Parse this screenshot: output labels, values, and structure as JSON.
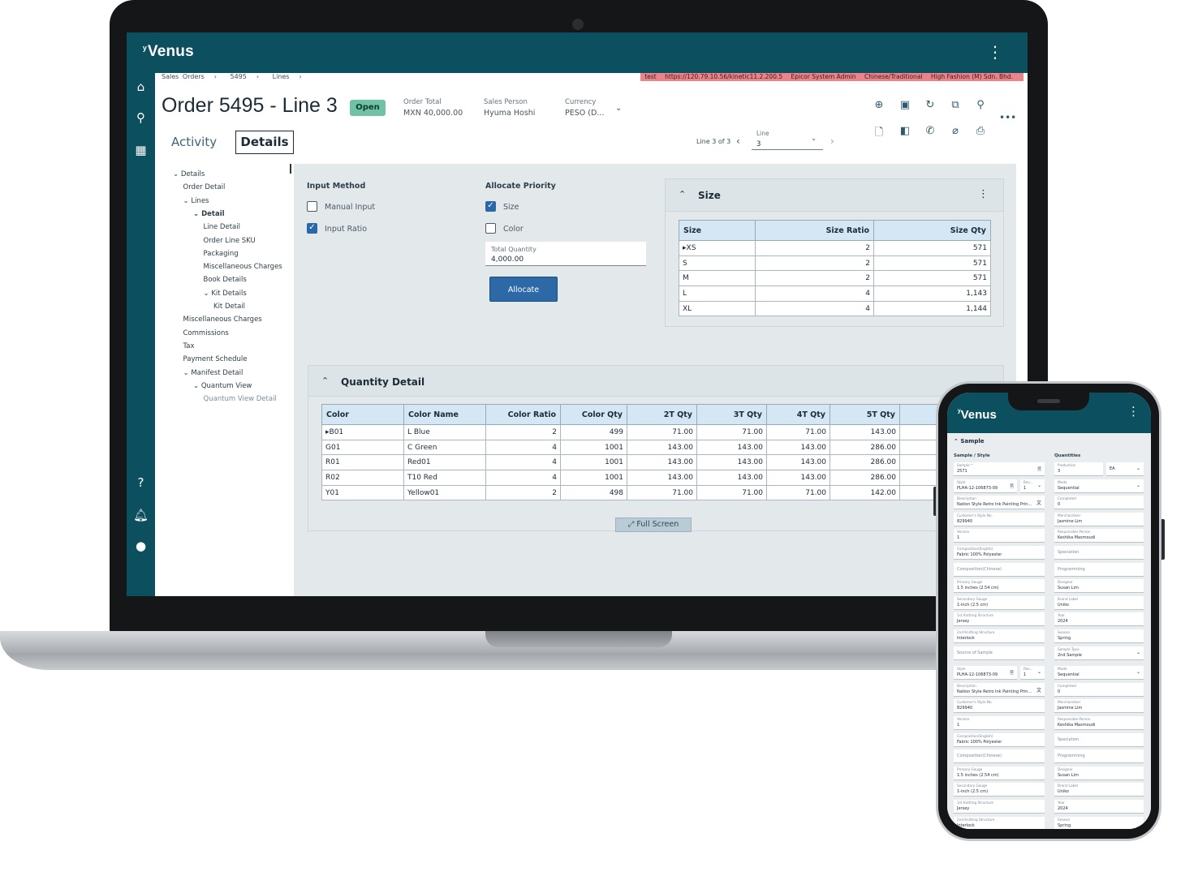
{
  "app": {
    "logo": "Venus",
    "logo_mark": "ʸ"
  },
  "breadcrumb": [
    "Sales Orders",
    "5495",
    "Lines"
  ],
  "environment": [
    "test",
    "https://120.79.10.56/kinetic11.2.200.5",
    "Epicor System Admin",
    "Chinese/Traditional",
    "High Fashion (M) Sdn. Bhd."
  ],
  "header": {
    "title": "Order 5495 - Line 3",
    "status": "Open",
    "order_total_label": "Order Total",
    "order_total_value": "MXN 40,000.00",
    "sales_person_label": "Sales Person",
    "sales_person_value": "Hyuma Hoshi",
    "currency_label": "Currency",
    "currency_value": "PESO (D..."
  },
  "tabs": {
    "activity": "Activity",
    "details": "Details"
  },
  "line_nav": {
    "position": "Line 3 of 3",
    "label": "Line",
    "value": "3"
  },
  "tree": [
    {
      "label": "Details",
      "prefix": "⌄ ",
      "level": 0
    },
    {
      "label": "Order Detail",
      "prefix": "",
      "level": 1
    },
    {
      "label": "Lines",
      "prefix": "⌄ ",
      "level": 1
    },
    {
      "label": "Detail",
      "prefix": "⌄ ",
      "level": 2
    },
    {
      "label": "Line Detail",
      "prefix": "",
      "level": 3
    },
    {
      "label": "Order Line SKU",
      "prefix": "",
      "level": 3
    },
    {
      "label": "Packaging",
      "prefix": "",
      "level": 3
    },
    {
      "label": "Miscellaneous Charges",
      "prefix": "",
      "level": 3
    },
    {
      "label": "Book Details",
      "prefix": "",
      "level": 3
    },
    {
      "label": "Kit Details",
      "prefix": "⌄ ",
      "level": 3
    },
    {
      "label": "Kit Detail",
      "prefix": "",
      "level": 4
    },
    {
      "label": "Miscellaneous Charges",
      "prefix": "",
      "level": 1
    },
    {
      "label": "Commissions",
      "prefix": "",
      "level": 1
    },
    {
      "label": "Tax",
      "prefix": "",
      "level": 1
    },
    {
      "label": "Payment Schedule",
      "prefix": "",
      "level": 1
    },
    {
      "label": "Manifest Detail",
      "prefix": "⌄ ",
      "level": 1
    },
    {
      "label": "Quantum View",
      "prefix": "⌄ ",
      "level": 2
    },
    {
      "label": "Quantum View Detail",
      "prefix": "",
      "level": 3
    }
  ],
  "input_method": {
    "label": "Input Method",
    "manual_input": "Manual Input",
    "manual_checked": false,
    "input_ratio": "Input Ratio",
    "ratio_checked": true
  },
  "allocate_priority": {
    "label": "Allocate Priority",
    "size": "Size",
    "size_checked": true,
    "color": "Color",
    "color_checked": false,
    "total_quantity_label": "Total Quantity",
    "total_quantity_value": "4,000.00",
    "allocate_button": "Allocate"
  },
  "size_card": {
    "title": "Size",
    "columns": [
      "Size",
      "Size Ratio",
      "Size Qty"
    ],
    "rows": [
      [
        "XS",
        "2",
        "571"
      ],
      [
        "S",
        "2",
        "571"
      ],
      [
        "M",
        "2",
        "571"
      ],
      [
        "L",
        "4",
        "1,143"
      ],
      [
        "XL",
        "4",
        "1,144"
      ]
    ]
  },
  "quantity_card": {
    "title": "Quantity Detail",
    "columns": [
      "Color",
      "Color Name",
      "Color Ratio",
      "Color Qty",
      "2T Qty",
      "3T Qty",
      "4T Qty",
      "5T Qty"
    ],
    "rows": [
      [
        "B01",
        "L Blue",
        "2",
        "499",
        "71.00",
        "71.00",
        "71.00",
        "143.00"
      ],
      [
        "G01",
        "C Green",
        "4",
        "1001",
        "143.00",
        "143.00",
        "143.00",
        "286.00"
      ],
      [
        "R01",
        "Red01",
        "4",
        "1001",
        "143.00",
        "143.00",
        "143.00",
        "286.00"
      ],
      [
        "R02",
        "T10 Red",
        "4",
        "1001",
        "143.00",
        "143.00",
        "143.00",
        "286.00"
      ],
      [
        "Y01",
        "Yellow01",
        "2",
        "498",
        "71.00",
        "71.00",
        "71.00",
        "142.00"
      ]
    ],
    "full_screen": "Full Screen"
  },
  "phone": {
    "logo": "Venus",
    "section": "Sample",
    "col_left": "Sample / Style",
    "col_right": "Quantities",
    "left_fields": [
      {
        "label": "Sample *",
        "value": "2571",
        "icon": "🗎"
      },
      {
        "label": "Style",
        "value": "PLHA-12-106873-09",
        "icon": "🗎"
      },
      {
        "label": "Description",
        "value": "Nation Style Retro Ink Painting Prin...",
        "icon": "文"
      },
      {
        "label": "Customer's Style No.",
        "value": "829940",
        "icon": ""
      },
      {
        "label": "Version",
        "value": "1",
        "icon": ""
      },
      {
        "label": "Composition(English)",
        "value": "Fabric 100% Polyester",
        "icon": ""
      },
      {
        "label": "Composition(Chinese)",
        "value": "",
        "icon": ""
      },
      {
        "label": "Primary Gauge",
        "value": "1.5 inches (2.54 cm)",
        "icon": ""
      },
      {
        "label": "Secondary Gauge",
        "value": "1-inch (2.5 cm)",
        "icon": ""
      },
      {
        "label": "1st Knitting Structure",
        "value": "Jersey",
        "icon": ""
      },
      {
        "label": "2nd Knitting Structure",
        "value": "Interlock",
        "icon": ""
      },
      {
        "label": "Source of Sample",
        "value": "",
        "icon": ""
      },
      {
        "label": "Style",
        "value": "PLHA-12-106873-09",
        "icon": "🗎"
      },
      {
        "label": "Description",
        "value": "Nation Style Retro Ink Painting Prin...",
        "icon": "文"
      },
      {
        "label": "Customer's Style No.",
        "value": "829940",
        "icon": ""
      },
      {
        "label": "Version",
        "value": "1",
        "icon": ""
      },
      {
        "label": "Composition(English)",
        "value": "Fabric 100% Polyester",
        "icon": ""
      },
      {
        "label": "Composition(Chinese)",
        "value": "",
        "icon": ""
      },
      {
        "label": "Primary Gauge",
        "value": "1.5 inches (2.54 cm)",
        "icon": ""
      },
      {
        "label": "Secondary Gauge",
        "value": "1-inch (2.5 cm)",
        "icon": ""
      },
      {
        "label": "1st Knitting Structure",
        "value": "Jersey",
        "icon": ""
      },
      {
        "label": "2nd Knitting Structure",
        "value": "Interlock",
        "icon": ""
      }
    ],
    "rev_fields": [
      {
        "label": "Rev...",
        "value": "1"
      },
      {
        "label": "Rev...",
        "value": "1"
      }
    ],
    "production_field": {
      "label": "Production",
      "value": "3",
      "unit": "EA"
    },
    "right_fields": [
      {
        "label": "Mode",
        "value": "Sequential",
        "icon": "⌄"
      },
      {
        "label": "Completed",
        "value": "0",
        "icon": ""
      },
      {
        "label": "Merchandiser",
        "value": "Jasmine Lim",
        "icon": ""
      },
      {
        "label": "Responsible Person",
        "value": "Keshika Masmoudi",
        "icon": ""
      },
      {
        "label": "Speciation",
        "value": "",
        "icon": ""
      },
      {
        "label": "Programming",
        "value": "",
        "icon": ""
      },
      {
        "label": "Designer",
        "value": "Susan Lim",
        "icon": ""
      },
      {
        "label": "Brand Label",
        "value": "Uniko",
        "icon": ""
      },
      {
        "label": "Year",
        "value": "2024",
        "icon": ""
      },
      {
        "label": "Season",
        "value": "Spring",
        "icon": ""
      },
      {
        "label": "Sample Type",
        "value": "2nd Sample",
        "icon": "⌄"
      },
      {
        "label": "Mode",
        "value": "Sequential",
        "icon": "⌄"
      },
      {
        "label": "Completed",
        "value": "0",
        "icon": ""
      },
      {
        "label": "Merchandiser",
        "value": "Jasmine Lim",
        "icon": ""
      },
      {
        "label": "Responsible Person",
        "value": "Keshika Masmoudi",
        "icon": ""
      },
      {
        "label": "Speciation",
        "value": "",
        "icon": ""
      },
      {
        "label": "Programming",
        "value": "",
        "icon": ""
      },
      {
        "label": "Designer",
        "value": "Susan Lim",
        "icon": ""
      },
      {
        "label": "Brand Label",
        "value": "Uniko",
        "icon": ""
      },
      {
        "label": "Year",
        "value": "2024",
        "icon": ""
      },
      {
        "label": "Season",
        "value": "Spring",
        "icon": ""
      }
    ]
  },
  "colors": {
    "brand": "#0c5060",
    "accent": "#2d69a6",
    "status_open": "#6fc2a4",
    "env_bar": "#e8848a"
  }
}
